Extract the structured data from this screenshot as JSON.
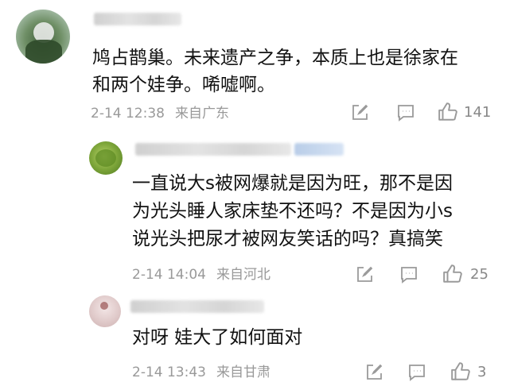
{
  "comments": [
    {
      "lines": [
        "鸠占鹊巢。未来遗产之争，本质上也是徐家在",
        "和两个娃争。唏嘘啊。"
      ],
      "time": "2-14 12:38",
      "location": "来自广东",
      "likes": "141"
    },
    {
      "lines": [
        "一直说大s被网爆就是因为旺，那不是因",
        "为光头睡人家床垫不还吗？不是因为小s",
        "说光头把尿才被网友笑话的吗？真搞笑"
      ],
      "time": "2-14 14:04",
      "location": "来自河北",
      "likes": "25"
    },
    {
      "lines": [
        "对呀 娃大了如何面对"
      ],
      "time": "2-14 13:43",
      "location": "来自甘肃",
      "likes": "3"
    }
  ],
  "colors": {
    "meta": "#999999",
    "icon": "#9a9a9a",
    "text": "#111111"
  },
  "icons": [
    "edit-icon",
    "comment-icon",
    "like-icon"
  ]
}
